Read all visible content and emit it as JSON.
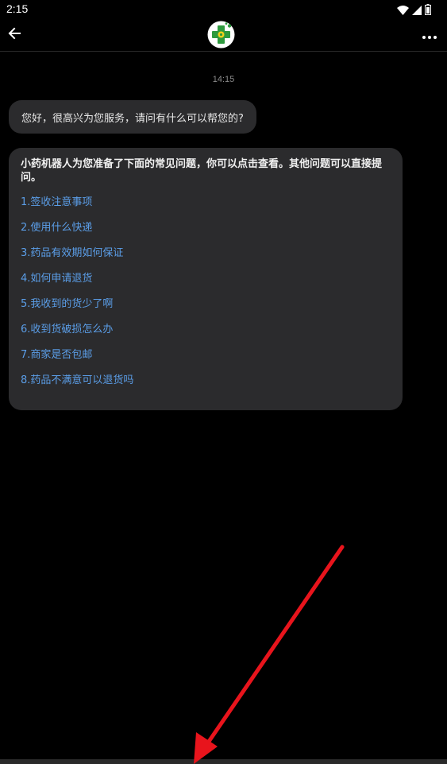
{
  "status_bar": {
    "time": "2:15"
  },
  "app_bar": {
    "back_icon": "arrow-left-icon",
    "logo_icon": "pharmacy-cross-logo",
    "more_icon": "more-horizontal-icon"
  },
  "chat": {
    "timestamp": "14:15",
    "greeting": "您好，很高兴为您服务，请问有什么可以帮您的?",
    "faq_intro": "小药机器人为您准备了下面的常见问题，你可以点击查看。其他问题可以直接提问。",
    "faq_items": [
      "1.签收注意事项",
      "2.使用什么快递",
      "3.药品有效期如何保证",
      "4.如何申请退货",
      "5.我收到的货少了啊",
      "6.收到货破损怎么办",
      "7.商家是否包邮",
      "8.药品不满意可以退货吗"
    ]
  },
  "colors": {
    "background": "#000000",
    "bubble": "#2b2b2d",
    "link": "#5b9ee8",
    "logo_green": "#2e9a3e",
    "logo_yellow": "#f2d21b",
    "annotation_red": "#e8141c"
  }
}
